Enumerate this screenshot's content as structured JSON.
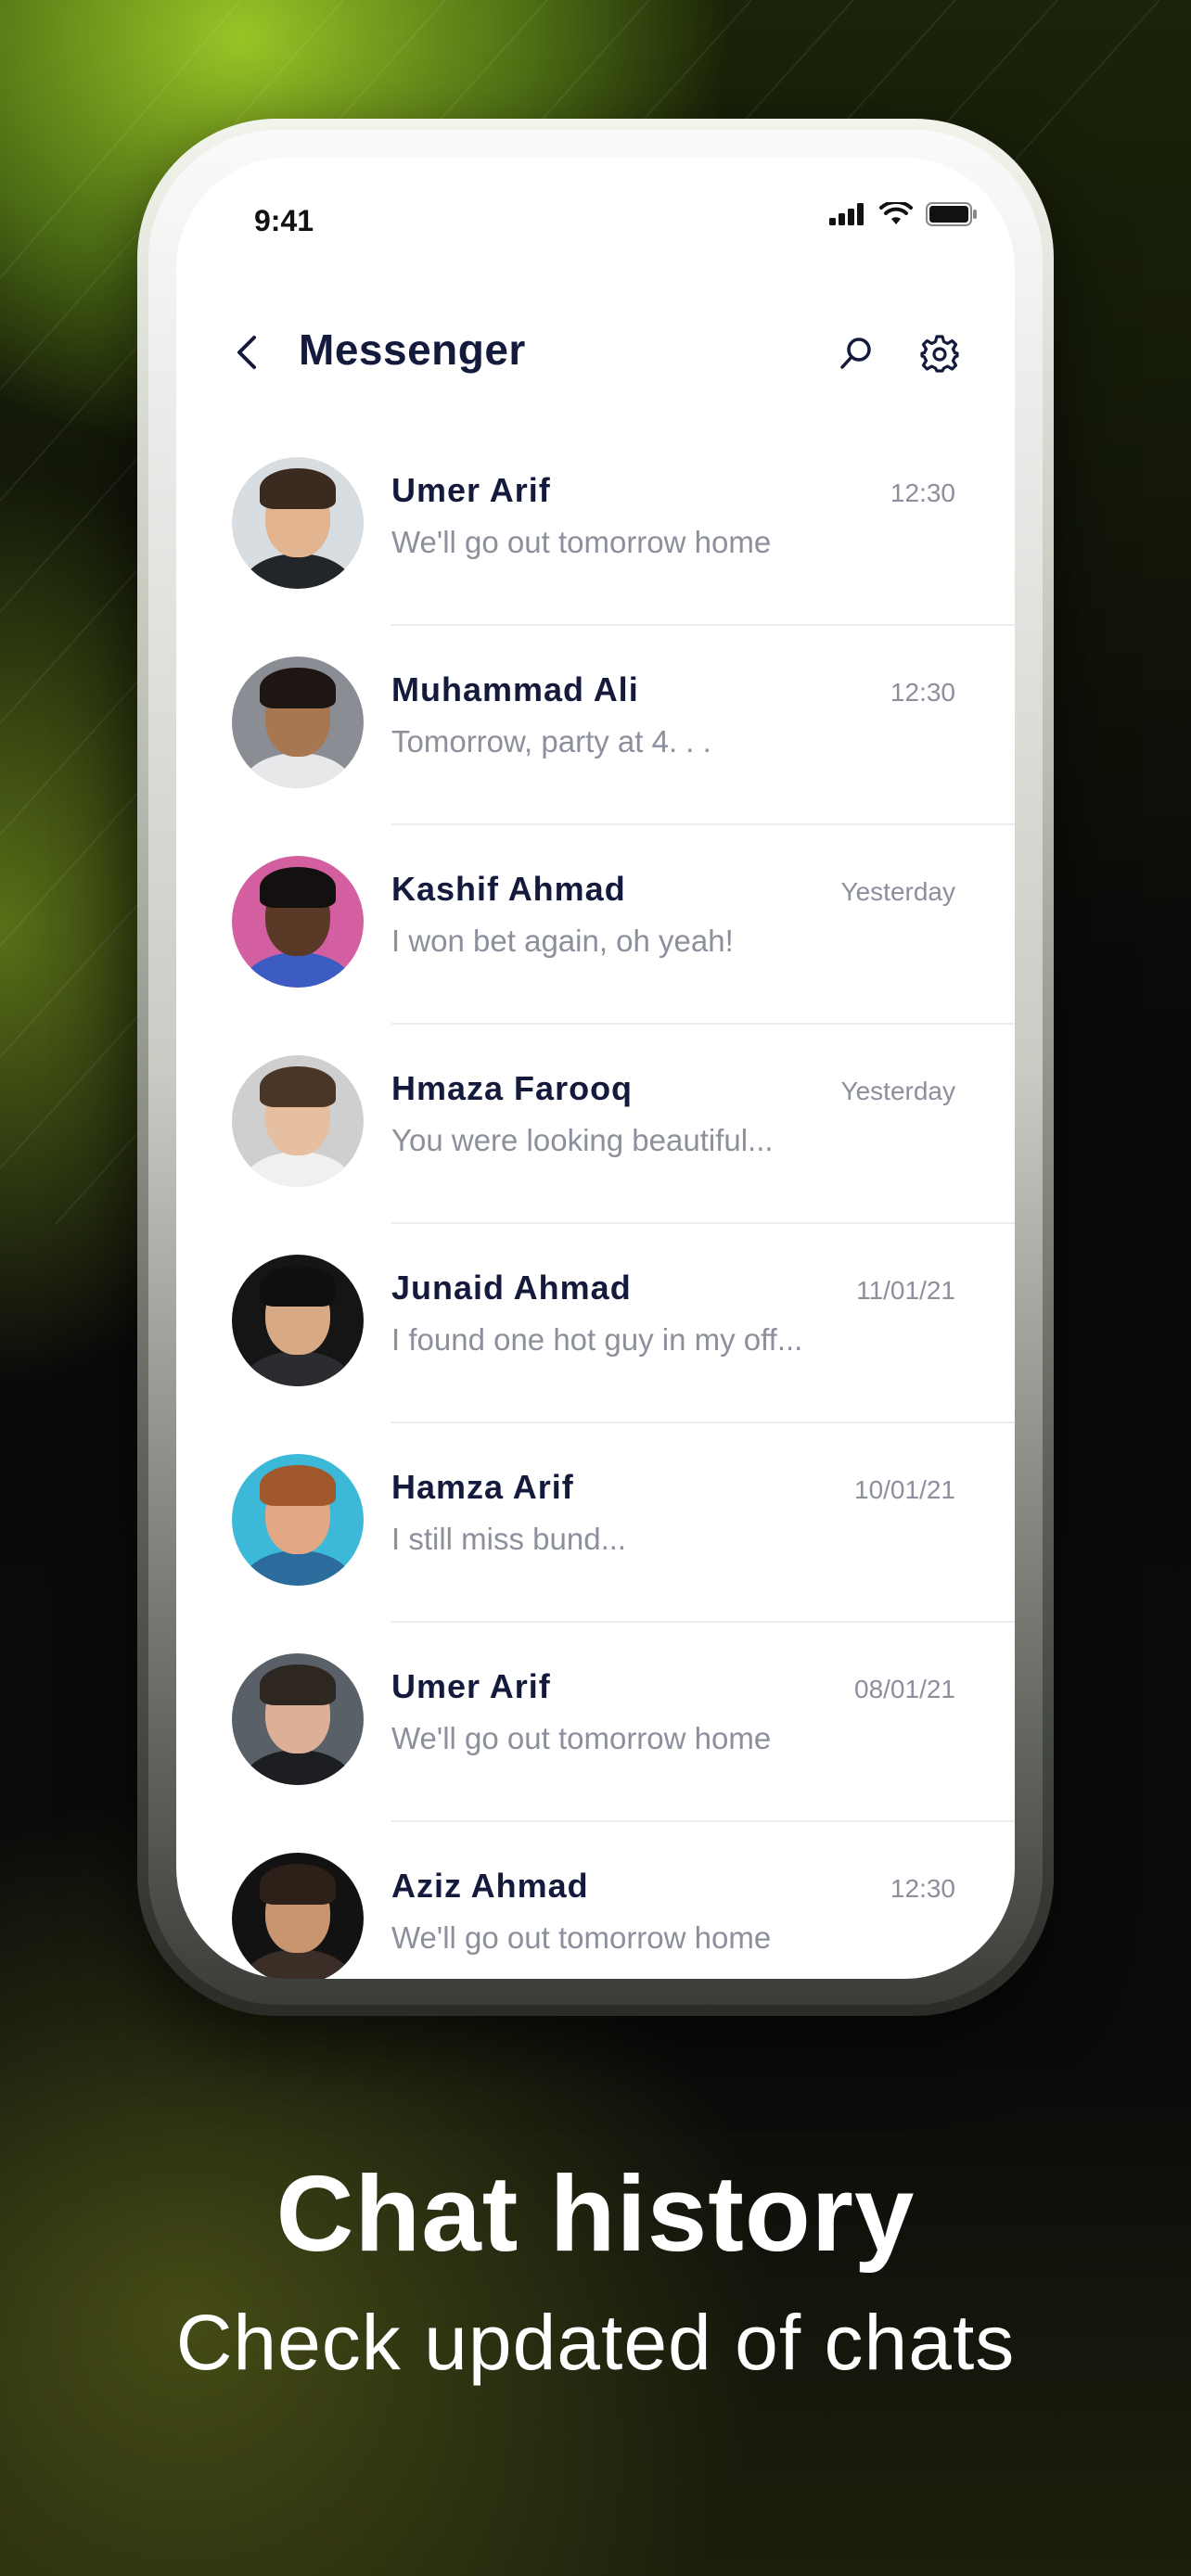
{
  "status_bar": {
    "time": "9:41"
  },
  "header": {
    "title": "Messenger"
  },
  "chats": [
    {
      "name": "Umer Arif",
      "preview": "We'll go out tomorrow home",
      "time": "12:30",
      "avatar": {
        "bg": "#d8dde2",
        "skin": "#e2b48f",
        "hair": "#3a2a20",
        "shirt": "#22262b"
      }
    },
    {
      "name": "Muhammad Ali",
      "preview": "Tomorrow, party at 4. . .",
      "time": "12:30",
      "avatar": {
        "bg": "#8a8d93",
        "skin": "#a87650",
        "hair": "#1d1612",
        "shirt": "#e8e8ea"
      }
    },
    {
      "name": "Kashif Ahmad",
      "preview": "I won bet again, oh yeah!",
      "time": "Yesterday",
      "avatar": {
        "bg": "#d35fa0",
        "skin": "#5a3a26",
        "hair": "#141010",
        "shirt": "#3c5cc4"
      }
    },
    {
      "name": "Hmaza Farooq",
      "preview": "You were looking beautiful...",
      "time": "Yesterday",
      "avatar": {
        "bg": "#cfcfd0",
        "skin": "#e6bfa0",
        "hair": "#4a3626",
        "shirt": "#f0f0f0"
      }
    },
    {
      "name": "Junaid Ahmad",
      "preview": "I found one hot guy in my off...",
      "time": "11/01/21",
      "avatar": {
        "bg": "#151515",
        "skin": "#d8a985",
        "hair": "#101010",
        "shirt": "#2a2c30"
      }
    },
    {
      "name": "Hamza Arif",
      "preview": "I still miss bund...",
      "time": "10/01/21",
      "avatar": {
        "bg": "#3cb8d8",
        "skin": "#e2a886",
        "hair": "#a0582c",
        "shirt": "#2c6c9c"
      }
    },
    {
      "name": "Umer Arif",
      "preview": "We'll go out tomorrow home",
      "time": "08/01/21",
      "avatar": {
        "bg": "#5a6068",
        "skin": "#dcb096",
        "hair": "#2e2620",
        "shirt": "#1c1e22"
      }
    },
    {
      "name": "Aziz Ahmad",
      "preview": "We'll go out tomorrow home",
      "time": "12:30",
      "avatar": {
        "bg": "#121212",
        "skin": "#c99470",
        "hair": "#2c2018",
        "shirt": "#3a2e26"
      }
    }
  ],
  "caption": {
    "title": "Chat history",
    "subtitle": "Check updated of chats"
  },
  "icons": {
    "back": "chevron-left-icon",
    "search": "search-icon",
    "settings": "gear-icon",
    "signal": "signal-icon",
    "wifi": "wifi-icon",
    "battery": "battery-icon"
  },
  "colors": {
    "title": "#141a3c",
    "secondary_text": "#8c8f9c",
    "accent_green": "#a6cf2a"
  }
}
